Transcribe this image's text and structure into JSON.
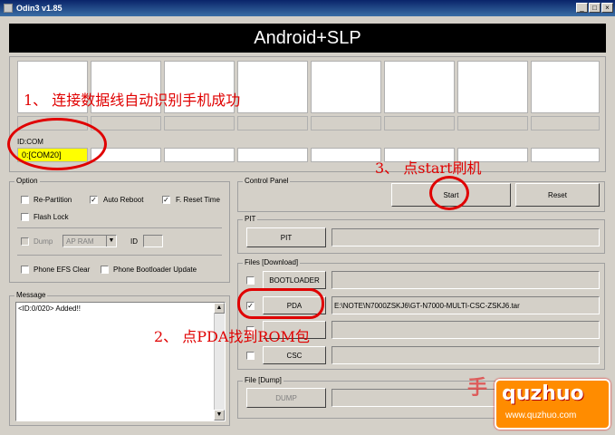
{
  "window": {
    "title": "Odin3 v1.85",
    "minimize": "_",
    "maximize": "□",
    "close": "×"
  },
  "banner": "Android+SLP",
  "id_com": {
    "label": "ID:COM",
    "first_port": "0:[COM20]"
  },
  "option": {
    "title": "Option",
    "re_partition": "Re-Partition",
    "auto_reboot": "Auto Reboot",
    "f_reset_time": "F. Reset Time",
    "flash_lock": "Flash Lock",
    "dump": "Dump",
    "dump_target": "AP RAM",
    "id_label": "ID",
    "phone_efs_clear": "Phone EFS Clear",
    "phone_bootloader_update": "Phone Bootloader Update"
  },
  "message": {
    "title": "Message",
    "text": "<ID:0/020> Added!!"
  },
  "control_panel": {
    "title": "Control Panel",
    "start": "Start",
    "reset": "Reset"
  },
  "pit": {
    "title": "PIT",
    "button": "PIT"
  },
  "files": {
    "title": "Files [Download]",
    "bootloader": "BOOTLOADER",
    "pda": "PDA",
    "pda_path": "E:\\NOTE\\N7000ZSKJ6\\GT-N7000-MULTI-CSC-ZSKJ6.tar",
    "csc": "CSC"
  },
  "file_dump": {
    "title": "File [Dump]",
    "button": "DUMP"
  },
  "annotations": {
    "step1": "1、 连接数据线自动识别手机成功",
    "step2": "2、 点PDA找到ROM包",
    "step3": "3、 点start刷机"
  },
  "watermark": {
    "logo": "quzhuo",
    "url": "www.quzhuo.com",
    "cn_logo": "手"
  },
  "colors": {
    "title_bar": "#0a246a",
    "com_highlight": "#ffff00",
    "annotation_red": "#e00000",
    "watermark_orange": "#ff8c00"
  }
}
